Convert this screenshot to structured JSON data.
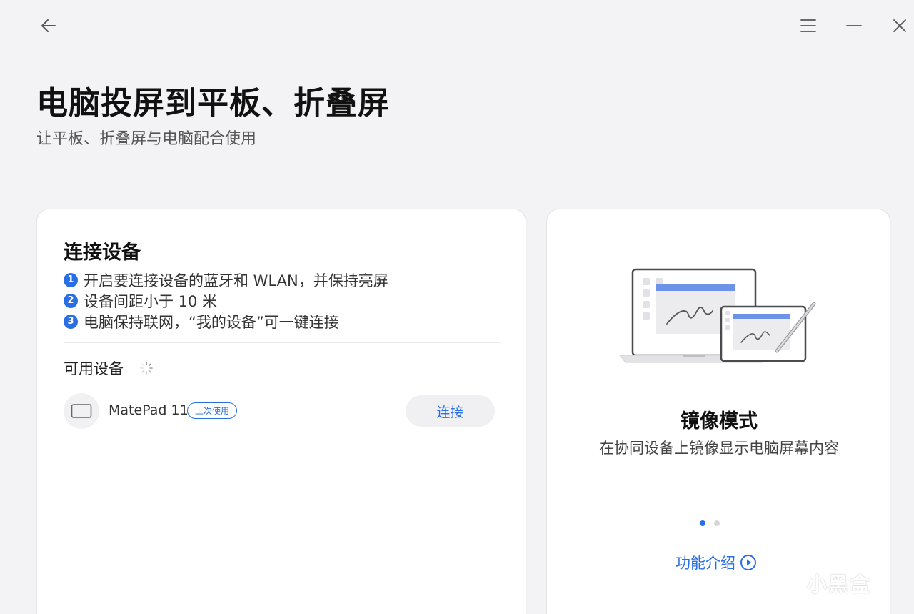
{
  "window": {
    "back_icon": "arrow-left-icon",
    "menu_icon": "hamburger-menu-icon",
    "minimize_icon": "minimize-icon",
    "close_icon": "close-icon"
  },
  "header": {
    "title": "电脑投屏到平板、折叠屏",
    "subtitle": "让平板、折叠屏与电脑配合使用"
  },
  "connect_card": {
    "title": "连接设备",
    "steps": [
      {
        "num": "1",
        "text": "开启要连接设备的蓝牙和 WLAN，并保持亮屏"
      },
      {
        "num": "2",
        "text": "设备间距小于 10 米"
      },
      {
        "num": "3",
        "text": "电脑保持联网，“我的设备”可一键连接"
      }
    ],
    "available_label": "可用设备",
    "devices": [
      {
        "name": "MatePad 11",
        "badge": "上次使用",
        "action": "连接",
        "icon": "tablet-icon"
      }
    ]
  },
  "mode_card": {
    "title": "镜像模式",
    "description": "在协同设备上镜像显示电脑屏幕内容",
    "page_count": 2,
    "active_page": 1,
    "feature_link": "功能介绍",
    "feature_icon": "play-circle-icon"
  },
  "watermark": {
    "text": "小黑盒"
  },
  "colors": {
    "accent": "#2a6ee6",
    "background": "#f3f3f5",
    "card": "#ffffff"
  }
}
